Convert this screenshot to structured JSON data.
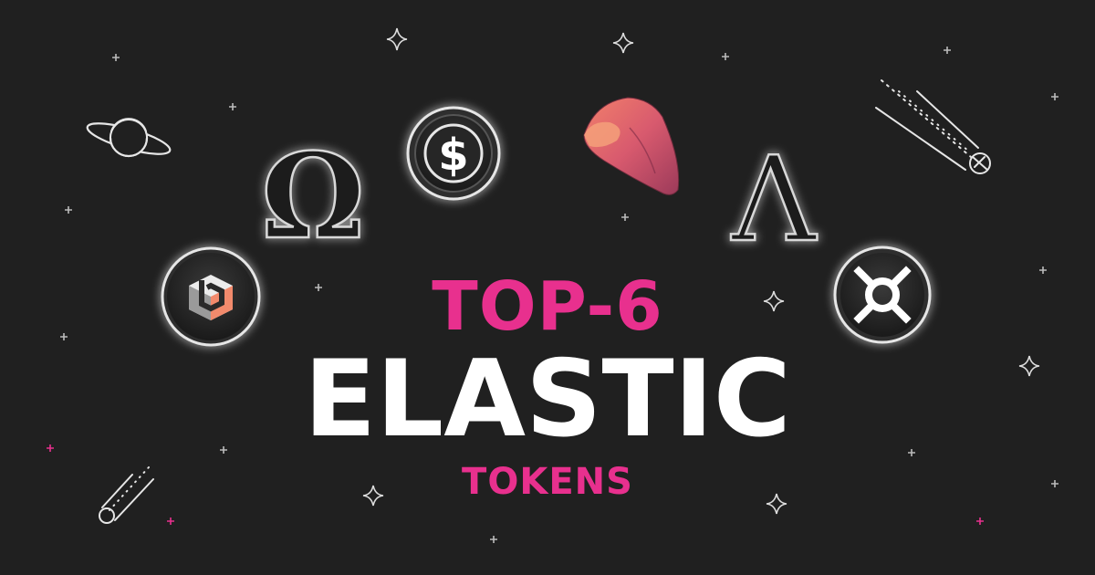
{
  "headline": {
    "line1": "TOP-6",
    "line2": "ELASTIC",
    "line3": "TOKENS"
  },
  "colors": {
    "background": "#202020",
    "accent": "#e8308e",
    "text": "#ffffff",
    "sweet_potato": "#c9506a"
  },
  "tokens": [
    {
      "icon": "basis-cash-icon"
    },
    {
      "icon": "olympus-omega-icon",
      "symbol": "Ω"
    },
    {
      "icon": "ampleforth-dollar-icon",
      "symbol": "$"
    },
    {
      "icon": "yam-sweet-potato-icon"
    },
    {
      "icon": "lambda-icon",
      "symbol": "Λ"
    },
    {
      "icon": "frax-icon"
    }
  ],
  "decorations": [
    "planet-icon",
    "comet-icon",
    "meteor-icon",
    "star-icon",
    "sparkle-icon"
  ]
}
